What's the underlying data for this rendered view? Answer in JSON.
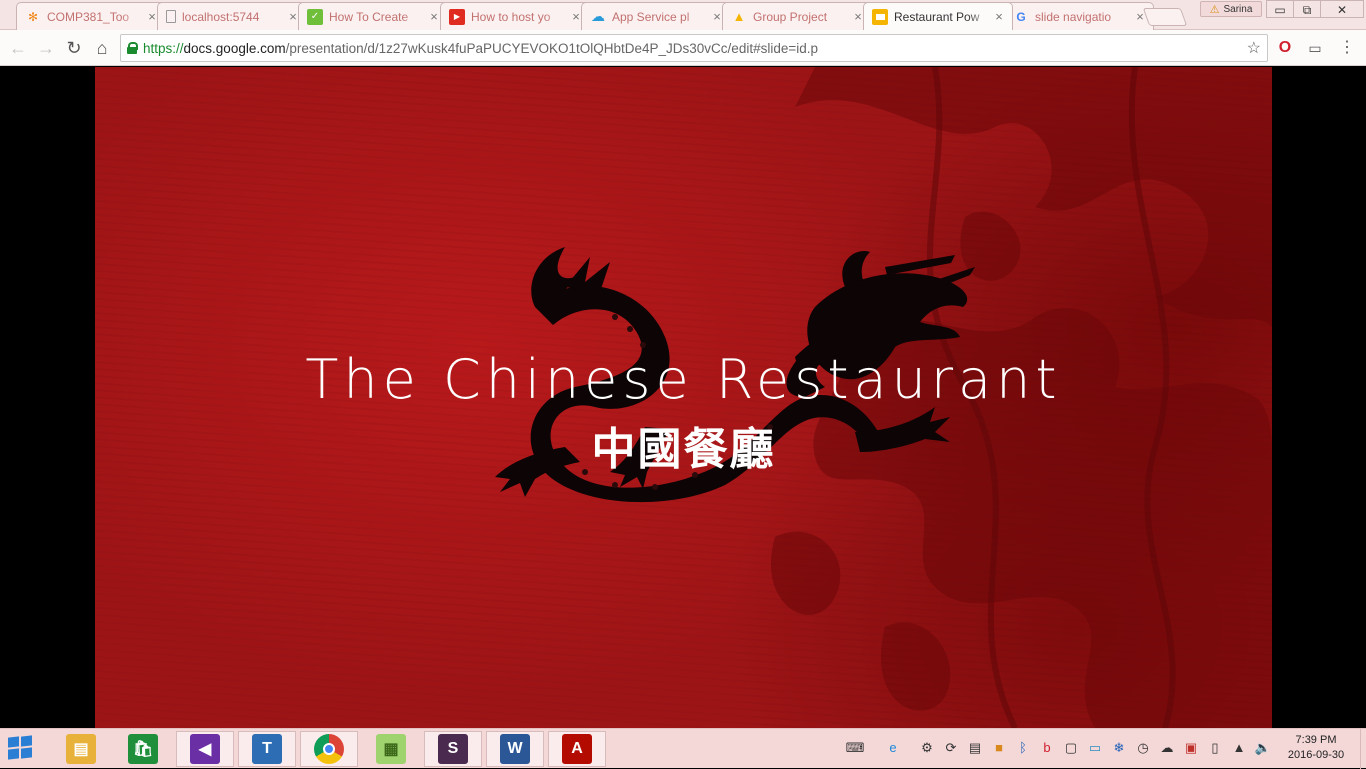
{
  "browser": {
    "tabs": [
      {
        "title": "COMP381_Too",
        "icon": "app-icon"
      },
      {
        "title": "localhost:5744",
        "icon": "page-icon"
      },
      {
        "title": "How To Create",
        "icon": "site-icon"
      },
      {
        "title": "How to host yo",
        "icon": "youtube-icon"
      },
      {
        "title": "App Service pl",
        "icon": "azure-icon"
      },
      {
        "title": "Group Project",
        "icon": "google-drive-icon"
      },
      {
        "title": "Restaurant Pow",
        "icon": "google-slides-icon"
      },
      {
        "title": "slide navigatio",
        "icon": "google-icon"
      }
    ],
    "active_tab_index": 6,
    "profile_name": "Sarina",
    "close_glyph": "×",
    "window_buttons": {
      "minimize": "▭",
      "restore": "⧉",
      "close": "✕"
    }
  },
  "address_bar": {
    "scheme": "https://",
    "host": "docs.google.com",
    "path": "/presentation/d/1z27wKusk4fuPaPUCYEVOKO1tOlQHbtDe4P_JDs30vCc/edit#slide=id.p"
  },
  "slide": {
    "title": "The Chinese Restaurant",
    "subtitle": "中國餐廳"
  },
  "taskbar": {
    "apps": [
      {
        "name": "file-explorer",
        "glyph": "▤",
        "color": "#e8b23a"
      },
      {
        "name": "store",
        "glyph": "🛍",
        "color": "#1f8f3b"
      },
      {
        "name": "visual-studio",
        "glyph": "◀",
        "color": "#6a2ea5"
      },
      {
        "name": "editor",
        "glyph": "T",
        "color": "#2c6db3"
      },
      {
        "name": "chrome",
        "glyph": "●",
        "color": "#d63b2f"
      },
      {
        "name": "sticky-notes",
        "glyph": "▦",
        "color": "#9fd36e"
      },
      {
        "name": "slack",
        "glyph": "S",
        "color": "#4b2a4f"
      },
      {
        "name": "word",
        "glyph": "W",
        "color": "#2b5797"
      },
      {
        "name": "acrobat",
        "glyph": "A",
        "color": "#b30b00"
      }
    ],
    "time": "7:39 PM",
    "date": "2016-09-30"
  }
}
